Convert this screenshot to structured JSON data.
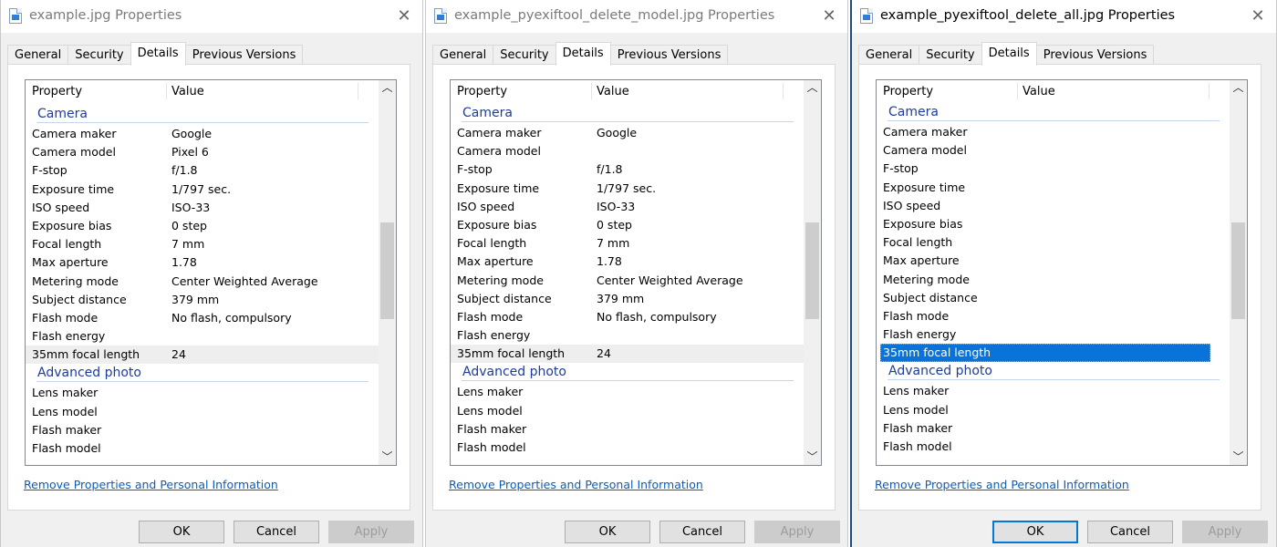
{
  "tabs": [
    "General",
    "Security",
    "Details",
    "Previous Versions"
  ],
  "selected_tab": "Details",
  "columns": {
    "property": "Property",
    "value": "Value"
  },
  "groups": {
    "camera": "Camera",
    "advanced": "Advanced photo"
  },
  "property_names": {
    "camera_maker": "Camera maker",
    "camera_model": "Camera model",
    "f_stop": "F-stop",
    "exposure_time": "Exposure time",
    "iso_speed": "ISO speed",
    "exposure_bias": "Exposure bias",
    "focal_length": "Focal length",
    "max_aperture": "Max aperture",
    "metering_mode": "Metering mode",
    "subject_distance": "Subject distance",
    "flash_mode": "Flash mode",
    "flash_energy": "Flash energy",
    "focal_length_35mm": "35mm focal length",
    "lens_maker": "Lens maker",
    "lens_model": "Lens model",
    "flash_maker": "Flash maker",
    "flash_model": "Flash model"
  },
  "remove_link": "Remove Properties and Personal Information",
  "buttons": {
    "ok": "OK",
    "cancel": "Cancel",
    "apply": "Apply"
  },
  "icons": {
    "close": "close-icon",
    "file": "image-file-icon",
    "scroll_up": "chevron-up-icon",
    "scroll_down": "chevron-down-icon"
  },
  "colors": {
    "group_text": "#1e3c9a",
    "link": "#0b5cbd",
    "selection": "#0a73d9"
  },
  "dialogs": [
    {
      "title": "example.jpg Properties",
      "active": false,
      "selected_row": "",
      "hover_row": "focal_length_35mm",
      "values": {
        "camera_maker": "Google",
        "camera_model": "Pixel 6",
        "f_stop": "f/1.8",
        "exposure_time": "1/797 sec.",
        "iso_speed": "ISO-33",
        "exposure_bias": "0 step",
        "focal_length": "7 mm",
        "max_aperture": "1.78",
        "metering_mode": "Center Weighted Average",
        "subject_distance": "379 mm",
        "flash_mode": "No flash, compulsory",
        "flash_energy": "",
        "focal_length_35mm": "24",
        "lens_maker": "",
        "lens_model": "",
        "flash_maker": "",
        "flash_model": ""
      }
    },
    {
      "title": "example_pyexiftool_delete_model.jpg Properties",
      "active": false,
      "selected_row": "",
      "hover_row": "focal_length_35mm",
      "values": {
        "camera_maker": "Google",
        "camera_model": "",
        "f_stop": "f/1.8",
        "exposure_time": "1/797 sec.",
        "iso_speed": "ISO-33",
        "exposure_bias": "0 step",
        "focal_length": "7 mm",
        "max_aperture": "1.78",
        "metering_mode": "Center Weighted Average",
        "subject_distance": "379 mm",
        "flash_mode": "No flash, compulsory",
        "flash_energy": "",
        "focal_length_35mm": "24",
        "lens_maker": "",
        "lens_model": "",
        "flash_maker": "",
        "flash_model": ""
      }
    },
    {
      "title": "example_pyexiftool_delete_all.jpg Properties",
      "active": true,
      "selected_row": "focal_length_35mm",
      "hover_row": "",
      "values": {
        "camera_maker": "",
        "camera_model": "",
        "f_stop": "",
        "exposure_time": "",
        "iso_speed": "",
        "exposure_bias": "",
        "focal_length": "",
        "max_aperture": "",
        "metering_mode": "",
        "subject_distance": "",
        "flash_mode": "",
        "flash_energy": "",
        "focal_length_35mm": "",
        "lens_maker": "",
        "lens_model": "",
        "flash_maker": "",
        "flash_model": ""
      }
    }
  ]
}
